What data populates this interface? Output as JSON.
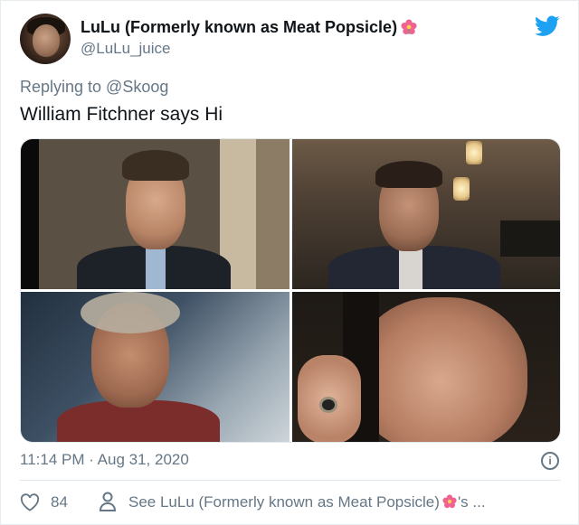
{
  "user": {
    "display_name": "LuLu (Formerly known as Meat Popsicle)",
    "handle": "@LuLu_juice",
    "name_emoji": "flower-icon"
  },
  "platform_icon": "twitter-bird-icon",
  "reply_line": "Replying to @Skoog",
  "tweet_text": "William Fitchner says Hi",
  "media": {
    "photos": [
      "photo-1",
      "photo-2",
      "photo-3",
      "photo-4"
    ]
  },
  "timestamp": "11:14 PM · Aug 31, 2020",
  "info_icon": "info-icon",
  "footer": {
    "like_count": "84",
    "see_text_prefix": "See LuLu (Formerly known as Meat Popsicle)",
    "see_text_suffix": "'s ..."
  },
  "colors": {
    "brand_blue": "#1DA1F2",
    "secondary_text": "#657786",
    "primary_text": "#0F1419",
    "flower": "#F06292"
  }
}
